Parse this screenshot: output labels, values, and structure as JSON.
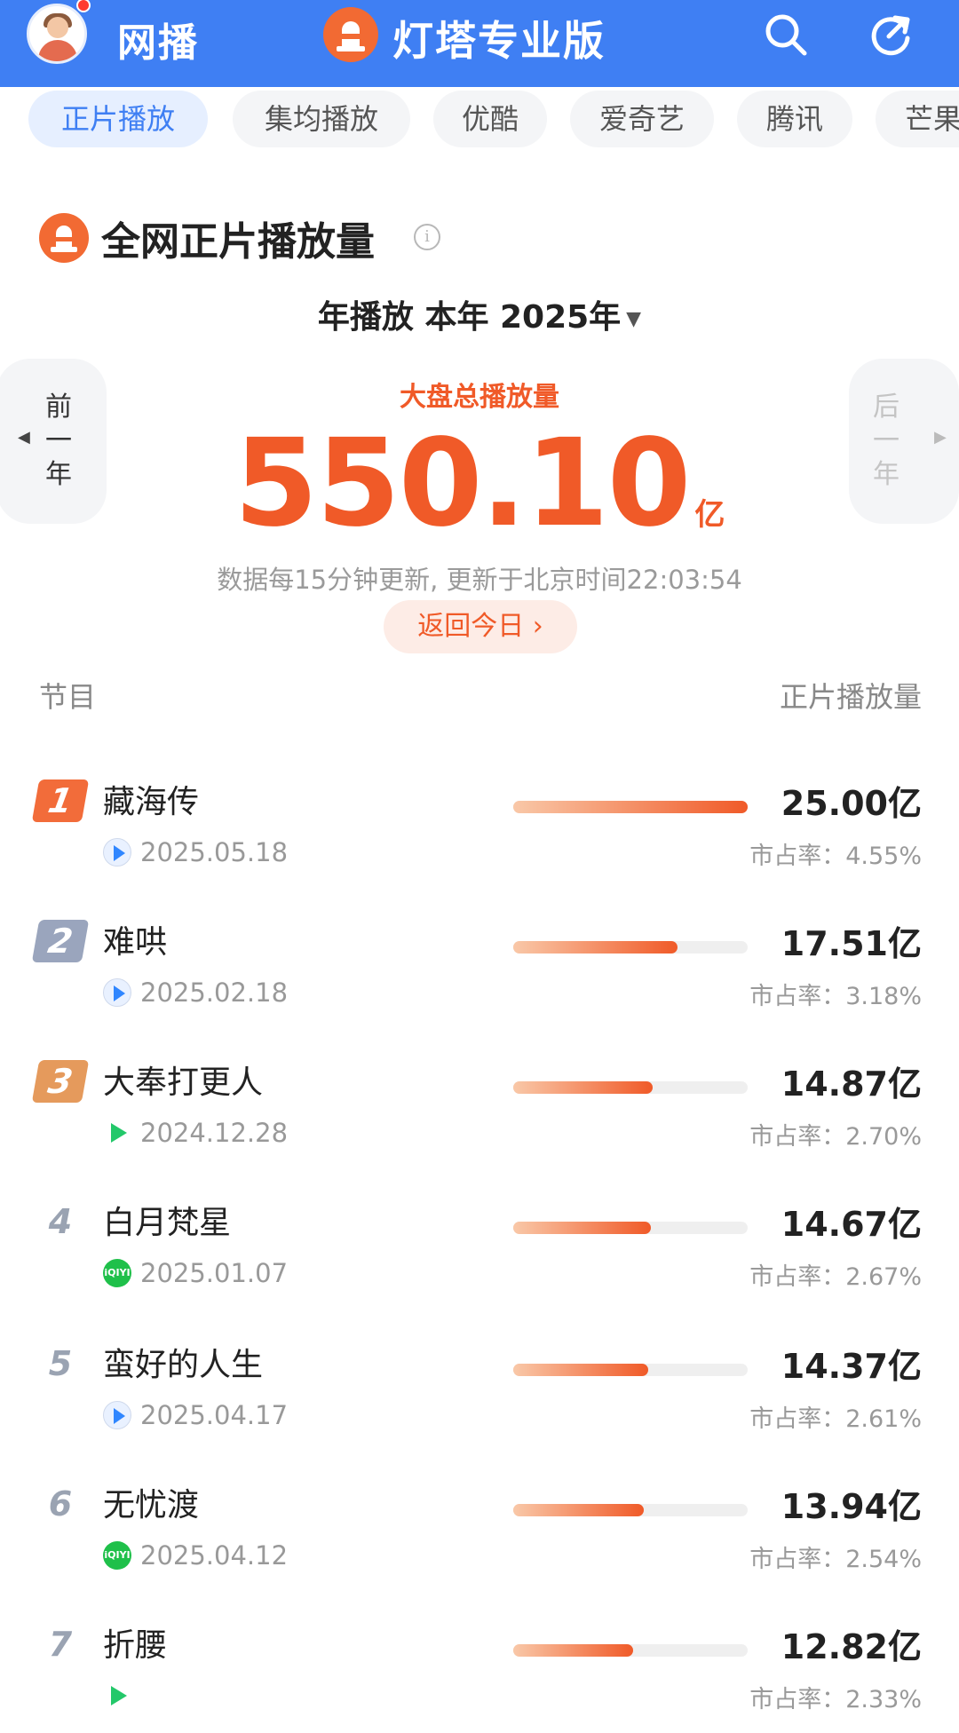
{
  "header": {
    "brand": "网播",
    "app_title": "灯塔专业版",
    "icons": [
      "avatar",
      "search-icon",
      "refresh-icon"
    ]
  },
  "tabs": [
    "正片播放",
    "集均播放",
    "优酷",
    "爱奇艺",
    "腾讯",
    "芒果"
  ],
  "active_tab": 0,
  "section": {
    "title": "全网正片播放量",
    "period": "年播放 本年 2025年",
    "prev_year": "前一年",
    "next_year": "后一年",
    "total_label": "大盘总播放量",
    "total_value": "550.10",
    "total_unit": "亿",
    "update_note": "数据每15分钟更新, 更新于北京时间22:03:54",
    "back_today": "返回今日 ›"
  },
  "columns": {
    "left": "节目",
    "right": "正片播放量"
  },
  "colors": {
    "accent": "#f05a28",
    "header_bg": "#3f7ff3",
    "tab_active": "#3f7ff3"
  },
  "list": [
    {
      "rank": "1",
      "title": "藏海传",
      "platform": "youku",
      "date": "2025.05.18",
      "value": "25.00亿",
      "share": "市占率：4.55%",
      "bar": 1.0
    },
    {
      "rank": "2",
      "title": "难哄",
      "platform": "youku",
      "date": "2025.02.18",
      "value": "17.51亿",
      "share": "市占率：3.18%",
      "bar": 0.7
    },
    {
      "rank": "3",
      "title": "大奉打更人",
      "platform": "tencent",
      "date": "2024.12.28",
      "value": "14.87亿",
      "share": "市占率：2.70%",
      "bar": 0.595
    },
    {
      "rank": "4",
      "title": "白月梵星",
      "platform": "iqiyi",
      "date": "2025.01.07",
      "value": "14.67亿",
      "share": "市占率：2.67%",
      "bar": 0.587
    },
    {
      "rank": "5",
      "title": "蛮好的人生",
      "platform": "youku",
      "date": "2025.04.17",
      "value": "14.37亿",
      "share": "市占率：2.61%",
      "bar": 0.575
    },
    {
      "rank": "6",
      "title": "无忧渡",
      "platform": "iqiyi",
      "date": "2025.04.12",
      "value": "13.94亿",
      "share": "市占率：2.54%",
      "bar": 0.558
    },
    {
      "rank": "7",
      "title": "折腰",
      "platform": "tencent",
      "date": "",
      "value": "12.82亿",
      "share": "市占率：2.33%",
      "bar": 0.513
    }
  ]
}
